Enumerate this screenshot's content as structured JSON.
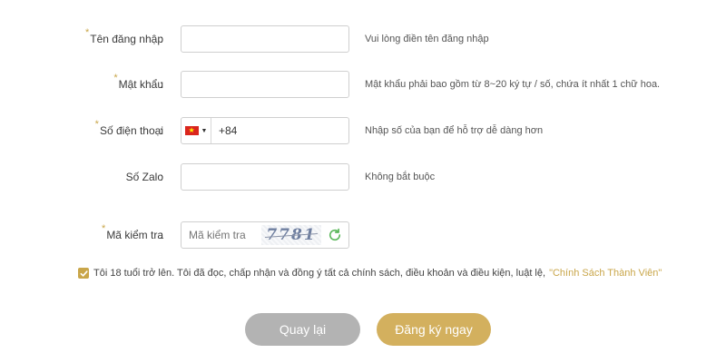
{
  "form": {
    "username": {
      "required_mark": "*",
      "label": "Tên đăng nhập",
      "colon": ":",
      "value": "",
      "hint": "Vui lòng điền tên đăng nhập"
    },
    "password": {
      "required_mark": "*",
      "label": "Mật khẩu",
      "colon": ":",
      "value": "",
      "hint": "Mật khẩu phải bao gồm từ 8~20 ký tự / số, chứa ít nhất 1 chữ hoa."
    },
    "phone": {
      "required_mark": "*",
      "label": "Số điện thoại",
      "colon": ":",
      "country_flag": "vietnam-flag-icon",
      "value": "+84",
      "hint": "Nhập số của bạn để hỗ trợ dễ dàng hơn"
    },
    "zalo": {
      "label": "Số Zalo",
      "colon": ":",
      "value": "",
      "hint": "Không bắt buộc"
    },
    "captcha": {
      "required_mark": "*",
      "label": "Mã kiểm tra",
      "colon": ":",
      "placeholder": "Mã kiểm tra",
      "code": "7781",
      "refresh_icon": "refresh-icon"
    }
  },
  "agreement": {
    "checked": true,
    "text": "Tôi 18 tuổi trở lên. Tôi đã đọc, chấp nhận và đồng ý tất cả chính sách, điều khoản và điều kiện, luật lệ,",
    "link_text": "\"Chính Sách Thành Viên\""
  },
  "buttons": {
    "back_label": "Quay lại",
    "register_label": "Đăng ký ngay"
  },
  "colors": {
    "accent": "#d3b05e",
    "required": "#c9a64a",
    "button_gray": "#b3b3b3",
    "border": "#cfcfcf"
  }
}
